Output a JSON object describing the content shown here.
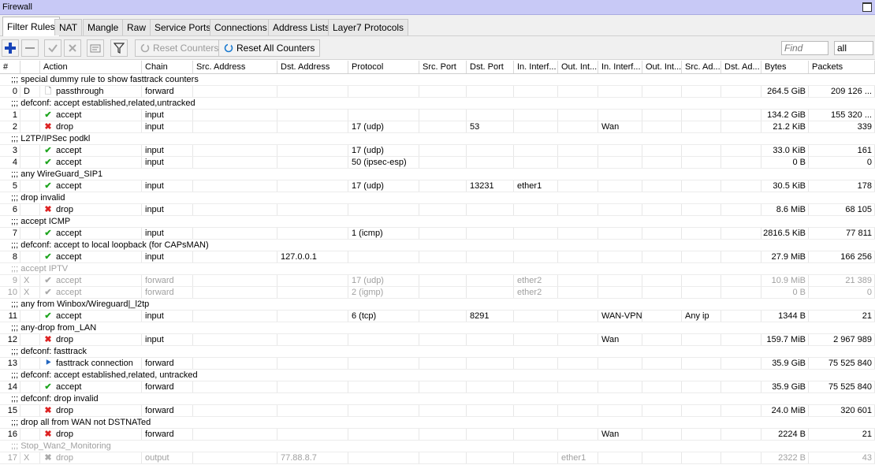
{
  "window": {
    "title": "Firewall"
  },
  "tabs": [
    "Filter Rules",
    "NAT",
    "Mangle",
    "Raw",
    "Service Ports",
    "Connections",
    "Address Lists",
    "Layer7 Protocols"
  ],
  "toolbar": {
    "reset_counters": "Reset Counters",
    "reset_all_counters": "Reset All Counters",
    "find_placeholder": "Find",
    "filter_value": "all"
  },
  "columns": [
    "#",
    "",
    "Action",
    "Chain",
    "Src. Address",
    "Dst. Address",
    "Protocol",
    "Src. Port",
    "Dst. Port",
    "In. Interf...",
    "Out. Int...",
    "In. Interf...",
    "Out. Int...",
    "Src. Ad...",
    "Dst. Ad...",
    "Bytes",
    "Packets"
  ],
  "rows": [
    {
      "type": "comment",
      "text": ";;; special dummy rule to show fasttrack counters"
    },
    {
      "type": "rule",
      "num": "0",
      "flag": "D",
      "icon": "passthrough-icon",
      "action": "passthrough",
      "chain": "forward",
      "src": "",
      "dst": "",
      "proto": "",
      "sport": "",
      "dport": "",
      "inif": "",
      "outif": "",
      "inifl": "",
      "outifl": "",
      "srcal": "",
      "dstal": "",
      "bytes": "264.5 GiB",
      "packets": "209 126 ..."
    },
    {
      "type": "comment",
      "text": ";;; defconf: accept established,related,untracked"
    },
    {
      "type": "rule",
      "num": "1",
      "flag": "",
      "icon": "check-icon",
      "action": "accept",
      "chain": "input",
      "src": "",
      "dst": "",
      "proto": "",
      "sport": "",
      "dport": "",
      "inif": "",
      "outif": "",
      "inifl": "",
      "outifl": "",
      "srcal": "",
      "dstal": "",
      "bytes": "134.2 GiB",
      "packets": "155 320 ..."
    },
    {
      "type": "rule",
      "num": "2",
      "flag": "",
      "icon": "x-icon",
      "action": "drop",
      "chain": "input",
      "src": "",
      "dst": "",
      "proto": "17 (udp)",
      "sport": "",
      "dport": "53",
      "inif": "",
      "outif": "",
      "inifl": "Wan",
      "outifl": "",
      "srcal": "",
      "dstal": "",
      "bytes": "21.2 KiB",
      "packets": "339"
    },
    {
      "type": "comment",
      "text": ";;; L2TP/IPSec podkl"
    },
    {
      "type": "rule",
      "num": "3",
      "flag": "",
      "icon": "check-icon",
      "action": "accept",
      "chain": "input",
      "src": "",
      "dst": "",
      "proto": "17 (udp)",
      "sport": "",
      "dport": "",
      "inif": "",
      "outif": "",
      "inifl": "",
      "outifl": "",
      "srcal": "",
      "dstal": "",
      "bytes": "33.0 KiB",
      "packets": "161"
    },
    {
      "type": "rule",
      "num": "4",
      "flag": "",
      "icon": "check-icon",
      "action": "accept",
      "chain": "input",
      "src": "",
      "dst": "",
      "proto": "50 (ipsec-esp)",
      "sport": "",
      "dport": "",
      "inif": "",
      "outif": "",
      "inifl": "",
      "outifl": "",
      "srcal": "",
      "dstal": "",
      "bytes": "0 B",
      "packets": "0"
    },
    {
      "type": "comment",
      "text": ";;; any WireGuard_SIP1"
    },
    {
      "type": "rule",
      "num": "5",
      "flag": "",
      "icon": "check-icon",
      "action": "accept",
      "chain": "input",
      "src": "",
      "dst": "",
      "proto": "17 (udp)",
      "sport": "",
      "dport": "13231",
      "inif": "ether1",
      "outif": "",
      "inifl": "",
      "outifl": "",
      "srcal": "",
      "dstal": "",
      "bytes": "30.5 KiB",
      "packets": "178"
    },
    {
      "type": "comment",
      "text": ";;; drop invalid"
    },
    {
      "type": "rule",
      "num": "6",
      "flag": "",
      "icon": "x-icon",
      "action": "drop",
      "chain": "input",
      "src": "",
      "dst": "",
      "proto": "",
      "sport": "",
      "dport": "",
      "inif": "",
      "outif": "",
      "inifl": "",
      "outifl": "",
      "srcal": "",
      "dstal": "",
      "bytes": "8.6 MiB",
      "packets": "68 105"
    },
    {
      "type": "comment",
      "text": ";;;  accept ICMP"
    },
    {
      "type": "rule",
      "num": "7",
      "flag": "",
      "icon": "check-icon",
      "action": "accept",
      "chain": "input",
      "src": "",
      "dst": "",
      "proto": "1 (icmp)",
      "sport": "",
      "dport": "",
      "inif": "",
      "outif": "",
      "inifl": "",
      "outifl": "",
      "srcal": "",
      "dstal": "",
      "bytes": "2816.5 KiB",
      "packets": "77 811"
    },
    {
      "type": "comment",
      "text": ";;; defconf: accept to local loopback (for CAPsMAN)"
    },
    {
      "type": "rule",
      "num": "8",
      "flag": "",
      "icon": "check-icon",
      "action": "accept",
      "chain": "input",
      "src": "",
      "dst": "127.0.0.1",
      "proto": "",
      "sport": "",
      "dport": "",
      "inif": "",
      "outif": "",
      "inifl": "",
      "outifl": "",
      "srcal": "",
      "dstal": "",
      "bytes": "27.9 MiB",
      "packets": "166 256"
    },
    {
      "type": "comment",
      "text": ";;; accept IPTV",
      "disabled": true
    },
    {
      "type": "rule",
      "num": "9",
      "flag": "X",
      "disabled": true,
      "icon": "check-icon",
      "action": "accept",
      "chain": "forward",
      "src": "",
      "dst": "",
      "proto": "17 (udp)",
      "sport": "",
      "dport": "",
      "inif": "ether2",
      "outif": "",
      "inifl": "",
      "outifl": "",
      "srcal": "",
      "dstal": "",
      "bytes": "10.9 MiB",
      "packets": "21 389"
    },
    {
      "type": "rule",
      "num": "10",
      "flag": "X",
      "disabled": true,
      "icon": "check-icon",
      "action": "accept",
      "chain": "forward",
      "src": "",
      "dst": "",
      "proto": "2 (igmp)",
      "sport": "",
      "dport": "",
      "inif": "ether2",
      "outif": "",
      "inifl": "",
      "outifl": "",
      "srcal": "",
      "dstal": "",
      "bytes": "0 B",
      "packets": "0"
    },
    {
      "type": "comment",
      "text": ";;; any from Winbox/Wireguard|_l2tp"
    },
    {
      "type": "rule",
      "num": "11",
      "flag": "",
      "icon": "check-icon",
      "action": "accept",
      "chain": "input",
      "src": "",
      "dst": "",
      "proto": "6 (tcp)",
      "sport": "",
      "dport": "8291",
      "inif": "",
      "outif": "",
      "inifl": "WAN-VPN",
      "outifl": "",
      "srcal": "Any ip",
      "dstal": "",
      "bytes": "1344 B",
      "packets": "21"
    },
    {
      "type": "comment",
      "text": ";;; any-drop from_LAN"
    },
    {
      "type": "rule",
      "num": "12",
      "flag": "",
      "icon": "x-icon",
      "action": "drop",
      "chain": "input",
      "src": "",
      "dst": "",
      "proto": "",
      "sport": "",
      "dport": "",
      "inif": "",
      "outif": "",
      "inifl": "Wan",
      "outifl": "",
      "srcal": "",
      "dstal": "",
      "bytes": "159.7 MiB",
      "packets": "2 967 989"
    },
    {
      "type": "comment",
      "text": ";;; defconf: fasttrack"
    },
    {
      "type": "rule",
      "num": "13",
      "flag": "",
      "icon": "fasttrack-icon",
      "action": "fasttrack connection",
      "chain": "forward",
      "src": "",
      "dst": "",
      "proto": "",
      "sport": "",
      "dport": "",
      "inif": "",
      "outif": "",
      "inifl": "",
      "outifl": "",
      "srcal": "",
      "dstal": "",
      "bytes": "35.9 GiB",
      "packets": "75 525 840"
    },
    {
      "type": "comment",
      "text": ";;; defconf: accept established,related, untracked"
    },
    {
      "type": "rule",
      "num": "14",
      "flag": "",
      "icon": "check-icon",
      "action": "accept",
      "chain": "forward",
      "src": "",
      "dst": "",
      "proto": "",
      "sport": "",
      "dport": "",
      "inif": "",
      "outif": "",
      "inifl": "",
      "outifl": "",
      "srcal": "",
      "dstal": "",
      "bytes": "35.9 GiB",
      "packets": "75 525 840"
    },
    {
      "type": "comment",
      "text": ";;; defconf: drop invalid"
    },
    {
      "type": "rule",
      "num": "15",
      "flag": "",
      "icon": "x-icon",
      "action": "drop",
      "chain": "forward",
      "src": "",
      "dst": "",
      "proto": "",
      "sport": "",
      "dport": "",
      "inif": "",
      "outif": "",
      "inifl": "",
      "outifl": "",
      "srcal": "",
      "dstal": "",
      "bytes": "24.0 MiB",
      "packets": "320 601"
    },
    {
      "type": "comment",
      "text": ";;; drop all from WAN not DSTNATed"
    },
    {
      "type": "rule",
      "num": "16",
      "flag": "",
      "icon": "x-icon",
      "action": "drop",
      "chain": "forward",
      "src": "",
      "dst": "",
      "proto": "",
      "sport": "",
      "dport": "",
      "inif": "",
      "outif": "",
      "inifl": "Wan",
      "outifl": "",
      "srcal": "",
      "dstal": "",
      "bytes": "2224 B",
      "packets": "21"
    },
    {
      "type": "comment",
      "text": ";;; Stop_Wan2_Monitoring",
      "disabled": true
    },
    {
      "type": "rule",
      "num": "17",
      "flag": "X",
      "disabled": true,
      "icon": "x-icon",
      "action": "drop",
      "chain": "output",
      "src": "",
      "dst": "77.88.8.7",
      "proto": "",
      "sport": "",
      "dport": "",
      "inif": "",
      "outif": "ether1",
      "inifl": "",
      "outifl": "",
      "srcal": "",
      "dstal": "",
      "bytes": "2322 B",
      "packets": "43"
    }
  ]
}
